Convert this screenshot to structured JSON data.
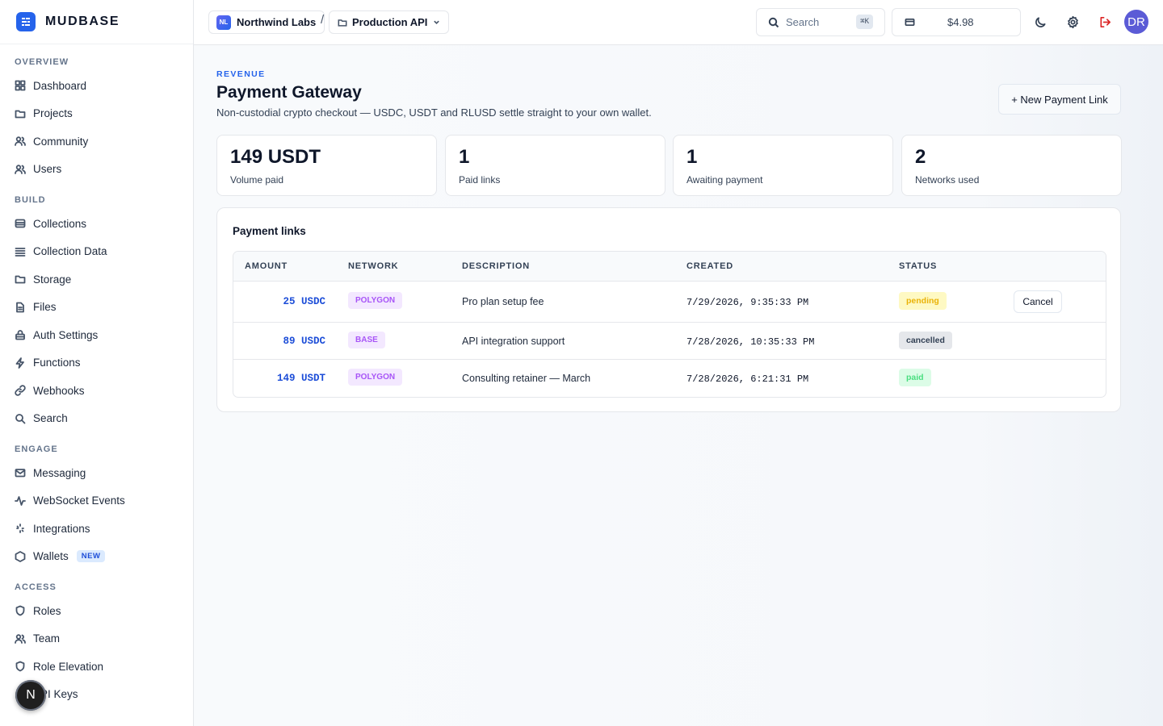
{
  "brand": {
    "name": "MUDBASE"
  },
  "sidebar": {
    "sections": [
      {
        "heading": "OVERVIEW",
        "items": [
          {
            "label": "Dashboard",
            "icon": "grid-icon"
          },
          {
            "label": "Projects",
            "icon": "folder-icon"
          },
          {
            "label": "Community",
            "icon": "users-icon"
          },
          {
            "label": "Users",
            "icon": "user-icon"
          }
        ]
      },
      {
        "heading": "BUILD",
        "items": [
          {
            "label": "Collections",
            "icon": "database-icon"
          },
          {
            "label": "Collection Data",
            "icon": "list-icon"
          },
          {
            "label": "Storage",
            "icon": "folder-icon"
          },
          {
            "label": "Files",
            "icon": "file-icon"
          },
          {
            "label": "Auth Settings",
            "icon": "lock-icon"
          },
          {
            "label": "Functions",
            "icon": "bolt-icon"
          },
          {
            "label": "Webhooks",
            "icon": "link-icon"
          },
          {
            "label": "Search",
            "icon": "search-icon"
          }
        ]
      },
      {
        "heading": "ENGAGE",
        "items": [
          {
            "label": "Messaging",
            "icon": "mail-icon"
          },
          {
            "label": "WebSocket Events",
            "icon": "activity-icon"
          },
          {
            "label": "Integrations",
            "icon": "sparkle-icon"
          },
          {
            "label": "Wallets",
            "icon": "hexagon-icon",
            "badge": "NEW"
          }
        ]
      },
      {
        "heading": "ACCESS",
        "items": [
          {
            "label": "Roles",
            "icon": "shield-icon"
          },
          {
            "label": "Team",
            "icon": "users-icon"
          },
          {
            "label": "Role Elevation",
            "icon": "shield-icon"
          },
          {
            "label": "API Keys",
            "icon": "key-icon"
          }
        ]
      }
    ],
    "floating_badge": "N"
  },
  "header": {
    "org": {
      "initials": "NL",
      "name": "Northwind Labs"
    },
    "separator": "/",
    "project": "Production API",
    "search": {
      "label": "Search",
      "shortcut": "⌘K"
    },
    "balance": "$4.98",
    "user_initials": "DR"
  },
  "page": {
    "eyebrow": "REVENUE",
    "title": "Payment Gateway",
    "subtitle": "Non-custodial crypto checkout — USDC, USDT and RLUSD settle straight to your own wallet.",
    "new_link_button": "+ New Payment Link"
  },
  "stats": [
    {
      "value": "149 USDT",
      "label": "Volume paid"
    },
    {
      "value": "1",
      "label": "Paid links"
    },
    {
      "value": "1",
      "label": "Awaiting payment"
    },
    {
      "value": "2",
      "label": "Networks used"
    }
  ],
  "payment_links": {
    "title": "Payment links",
    "columns": [
      "AMOUNT",
      "NETWORK",
      "DESCRIPTION",
      "CREATED",
      "STATUS"
    ],
    "rows": [
      {
        "amount": "25 USDC",
        "network": "POLYGON",
        "description": "Pro plan setup fee",
        "created": "7/29/2026, 9:35:33 PM",
        "status": "pending",
        "action": "Cancel"
      },
      {
        "amount": "89 USDC",
        "network": "BASE",
        "description": "API integration support",
        "created": "7/28/2026, 10:35:33 PM",
        "status": "cancelled"
      },
      {
        "amount": "149 USDT",
        "network": "POLYGON",
        "description": "Consulting retainer — March",
        "created": "7/28/2026, 6:21:31 PM",
        "status": "paid"
      }
    ]
  },
  "colors": {
    "accent": "#2563eb",
    "pending": "#eab308",
    "paid": "#4ade80",
    "network": "#a855f7",
    "danger": "#dc2626"
  }
}
